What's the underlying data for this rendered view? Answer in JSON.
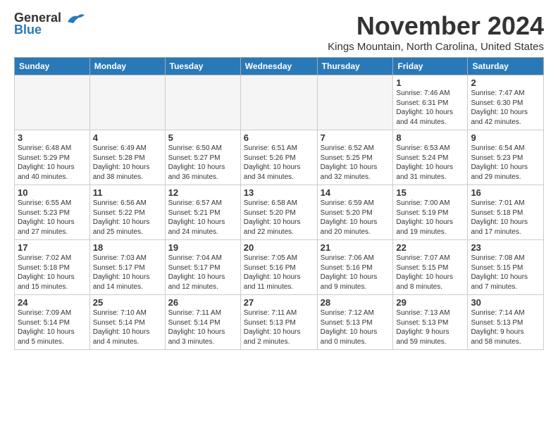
{
  "logo": {
    "line1": "General",
    "line2": "Blue"
  },
  "title": "November 2024",
  "location": "Kings Mountain, North Carolina, United States",
  "days_of_week": [
    "Sunday",
    "Monday",
    "Tuesday",
    "Wednesday",
    "Thursday",
    "Friday",
    "Saturday"
  ],
  "weeks": [
    [
      {
        "day": "",
        "info": ""
      },
      {
        "day": "",
        "info": ""
      },
      {
        "day": "",
        "info": ""
      },
      {
        "day": "",
        "info": ""
      },
      {
        "day": "",
        "info": ""
      },
      {
        "day": "1",
        "info": "Sunrise: 7:46 AM\nSunset: 6:31 PM\nDaylight: 10 hours\nand 44 minutes."
      },
      {
        "day": "2",
        "info": "Sunrise: 7:47 AM\nSunset: 6:30 PM\nDaylight: 10 hours\nand 42 minutes."
      }
    ],
    [
      {
        "day": "3",
        "info": "Sunrise: 6:48 AM\nSunset: 5:29 PM\nDaylight: 10 hours\nand 40 minutes."
      },
      {
        "day": "4",
        "info": "Sunrise: 6:49 AM\nSunset: 5:28 PM\nDaylight: 10 hours\nand 38 minutes."
      },
      {
        "day": "5",
        "info": "Sunrise: 6:50 AM\nSunset: 5:27 PM\nDaylight: 10 hours\nand 36 minutes."
      },
      {
        "day": "6",
        "info": "Sunrise: 6:51 AM\nSunset: 5:26 PM\nDaylight: 10 hours\nand 34 minutes."
      },
      {
        "day": "7",
        "info": "Sunrise: 6:52 AM\nSunset: 5:25 PM\nDaylight: 10 hours\nand 32 minutes."
      },
      {
        "day": "8",
        "info": "Sunrise: 6:53 AM\nSunset: 5:24 PM\nDaylight: 10 hours\nand 31 minutes."
      },
      {
        "day": "9",
        "info": "Sunrise: 6:54 AM\nSunset: 5:23 PM\nDaylight: 10 hours\nand 29 minutes."
      }
    ],
    [
      {
        "day": "10",
        "info": "Sunrise: 6:55 AM\nSunset: 5:23 PM\nDaylight: 10 hours\nand 27 minutes."
      },
      {
        "day": "11",
        "info": "Sunrise: 6:56 AM\nSunset: 5:22 PM\nDaylight: 10 hours\nand 25 minutes."
      },
      {
        "day": "12",
        "info": "Sunrise: 6:57 AM\nSunset: 5:21 PM\nDaylight: 10 hours\nand 24 minutes."
      },
      {
        "day": "13",
        "info": "Sunrise: 6:58 AM\nSunset: 5:20 PM\nDaylight: 10 hours\nand 22 minutes."
      },
      {
        "day": "14",
        "info": "Sunrise: 6:59 AM\nSunset: 5:20 PM\nDaylight: 10 hours\nand 20 minutes."
      },
      {
        "day": "15",
        "info": "Sunrise: 7:00 AM\nSunset: 5:19 PM\nDaylight: 10 hours\nand 19 minutes."
      },
      {
        "day": "16",
        "info": "Sunrise: 7:01 AM\nSunset: 5:18 PM\nDaylight: 10 hours\nand 17 minutes."
      }
    ],
    [
      {
        "day": "17",
        "info": "Sunrise: 7:02 AM\nSunset: 5:18 PM\nDaylight: 10 hours\nand 15 minutes."
      },
      {
        "day": "18",
        "info": "Sunrise: 7:03 AM\nSunset: 5:17 PM\nDaylight: 10 hours\nand 14 minutes."
      },
      {
        "day": "19",
        "info": "Sunrise: 7:04 AM\nSunset: 5:17 PM\nDaylight: 10 hours\nand 12 minutes."
      },
      {
        "day": "20",
        "info": "Sunrise: 7:05 AM\nSunset: 5:16 PM\nDaylight: 10 hours\nand 11 minutes."
      },
      {
        "day": "21",
        "info": "Sunrise: 7:06 AM\nSunset: 5:16 PM\nDaylight: 10 hours\nand 9 minutes."
      },
      {
        "day": "22",
        "info": "Sunrise: 7:07 AM\nSunset: 5:15 PM\nDaylight: 10 hours\nand 8 minutes."
      },
      {
        "day": "23",
        "info": "Sunrise: 7:08 AM\nSunset: 5:15 PM\nDaylight: 10 hours\nand 7 minutes."
      }
    ],
    [
      {
        "day": "24",
        "info": "Sunrise: 7:09 AM\nSunset: 5:14 PM\nDaylight: 10 hours\nand 5 minutes."
      },
      {
        "day": "25",
        "info": "Sunrise: 7:10 AM\nSunset: 5:14 PM\nDaylight: 10 hours\nand 4 minutes."
      },
      {
        "day": "26",
        "info": "Sunrise: 7:11 AM\nSunset: 5:14 PM\nDaylight: 10 hours\nand 3 minutes."
      },
      {
        "day": "27",
        "info": "Sunrise: 7:11 AM\nSunset: 5:13 PM\nDaylight: 10 hours\nand 2 minutes."
      },
      {
        "day": "28",
        "info": "Sunrise: 7:12 AM\nSunset: 5:13 PM\nDaylight: 10 hours\nand 0 minutes."
      },
      {
        "day": "29",
        "info": "Sunrise: 7:13 AM\nSunset: 5:13 PM\nDaylight: 9 hours\nand 59 minutes."
      },
      {
        "day": "30",
        "info": "Sunrise: 7:14 AM\nSunset: 5:13 PM\nDaylight: 9 hours\nand 58 minutes."
      }
    ]
  ]
}
